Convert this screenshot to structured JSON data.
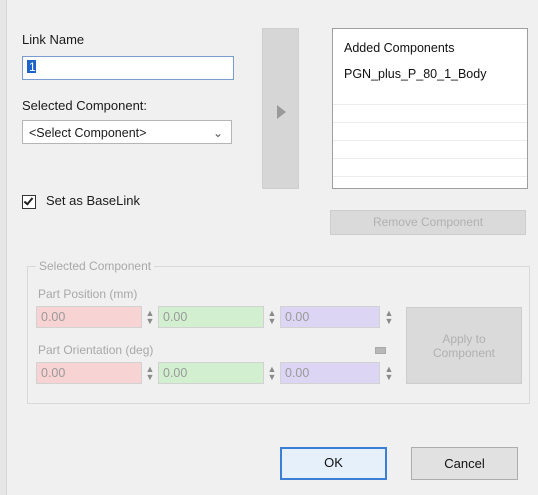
{
  "link_name": {
    "label": "Link Name",
    "value": "1"
  },
  "selected_component": {
    "label": "Selected Component:",
    "selected": "<Select Component>"
  },
  "added_components": {
    "header": "Added Components",
    "items": [
      "PGN_plus_P_80_1_Body"
    ]
  },
  "set_as_base_link": {
    "label": "Set as BaseLink",
    "checked": true
  },
  "remove_component_label": "Remove Component",
  "group": {
    "title": "Selected Component",
    "position_label": "Part Position (mm)",
    "position": [
      "0.00",
      "0.00",
      "0.00"
    ],
    "orientation_label": "Part Orientation (deg)",
    "orientation": [
      "0.00",
      "0.00",
      "0.00"
    ],
    "apply_label_line1": "Apply to",
    "apply_label_line2": "Component"
  },
  "buttons": {
    "ok": "OK",
    "cancel": "Cancel"
  },
  "colors": {
    "x_field": "#f8d3d3",
    "y_field": "#d2f0cf",
    "z_field": "#dcd5f3",
    "default_button_border": "#3c7fd6"
  }
}
